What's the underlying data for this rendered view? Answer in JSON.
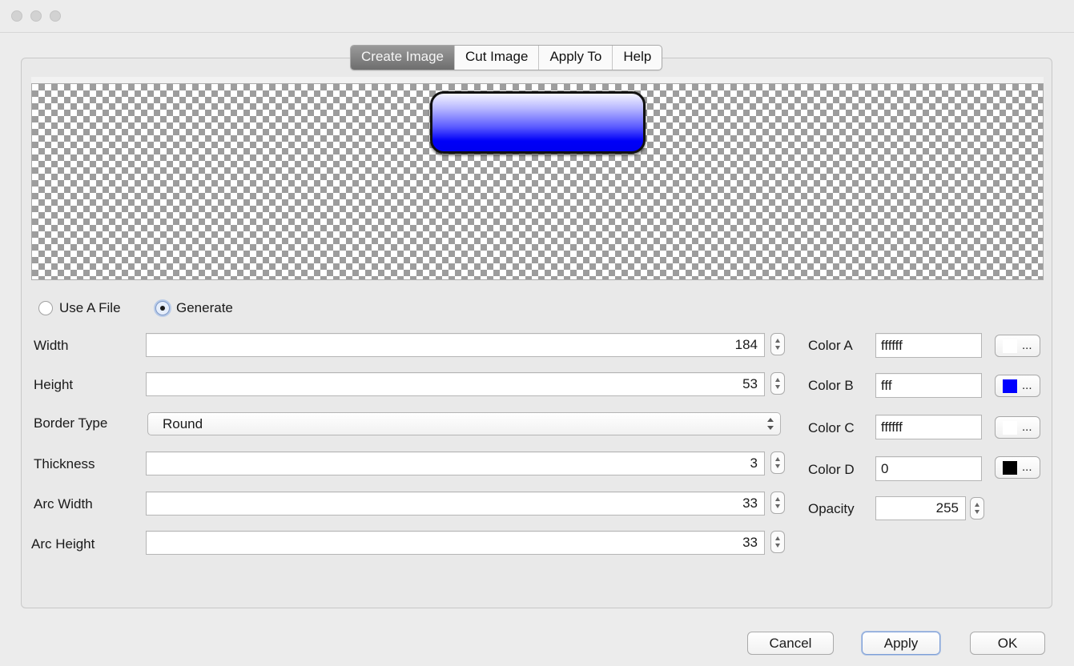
{
  "tabs": [
    "Create Image",
    "Cut Image",
    "Apply To",
    "Help"
  ],
  "source": {
    "use_file": "Use A File",
    "generate": "Generate",
    "selected": "Generate"
  },
  "fields": {
    "width": {
      "label": "Width",
      "value": "184"
    },
    "height": {
      "label": "Height",
      "value": "53"
    },
    "border_type": {
      "label": "Border Type",
      "value": "Round"
    },
    "thickness": {
      "label": "Thickness",
      "value": "3"
    },
    "arc_width": {
      "label": "Arc Width",
      "value": "33"
    },
    "arc_height": {
      "label": "Arc Height",
      "value": "33"
    }
  },
  "colors": {
    "a": {
      "label": "Color A",
      "value": "ffffff",
      "swatch": "#ffffff"
    },
    "b": {
      "label": "Color B",
      "value": "fff",
      "swatch": "#0000ff"
    },
    "c": {
      "label": "Color C",
      "value": "ffffff",
      "swatch": "#ffffff"
    },
    "d": {
      "label": "Color D",
      "value": "0",
      "swatch": "#000000"
    },
    "picker_label": "..."
  },
  "opacity": {
    "label": "Opacity",
    "value": "255"
  },
  "buttons": {
    "cancel": "Cancel",
    "apply": "Apply",
    "ok": "OK"
  }
}
